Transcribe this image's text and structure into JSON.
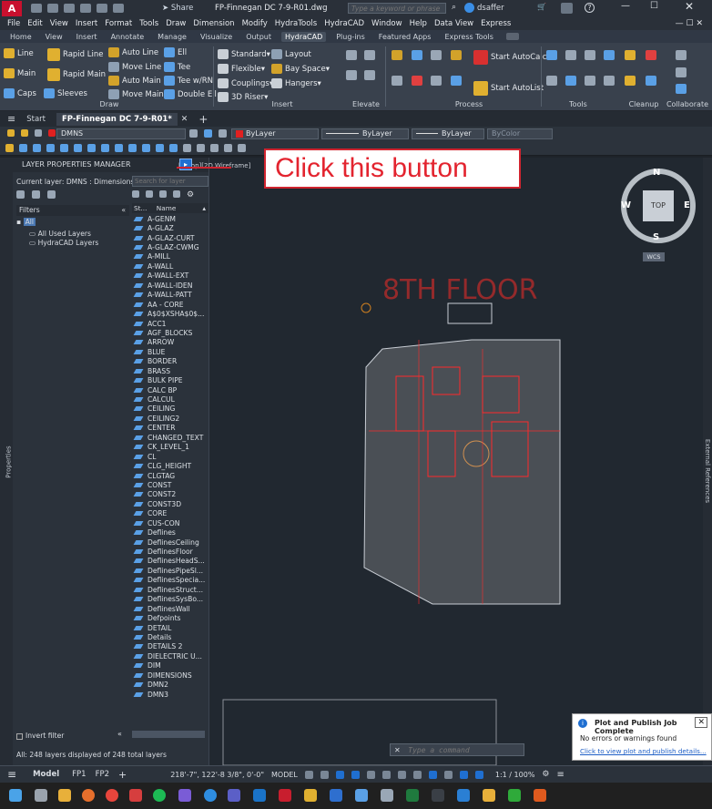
{
  "titlebar": {
    "logo": "A",
    "title": "FP-Finnegan DC 7-9-R01.dwg",
    "search_placeholder": "Type a keyword or phrase",
    "user": "dsaffer",
    "share": "Share"
  },
  "menu": [
    "File",
    "Edit",
    "View",
    "Insert",
    "Format",
    "Tools",
    "Draw",
    "Dimension",
    "Modify",
    "HydraTools",
    "HydraCAD",
    "Window",
    "Help",
    "Data View",
    "Express"
  ],
  "ribbon_tabs": [
    "Home",
    "View",
    "Insert",
    "Annotate",
    "Manage",
    "Visualize",
    "Output",
    "HydraCAD",
    "Plug-ins",
    "Featured Apps",
    "Express Tools"
  ],
  "ribbon_active": "HydraCAD",
  "ribbon": {
    "draw": [
      "Line",
      "Rapid Line",
      "Auto Line",
      "Ell",
      "Main",
      "Rapid Main",
      "Move Line",
      "Tee",
      "Caps",
      "Sleeves",
      "Auto Main",
      "Tee w/RN",
      "Move Main",
      "Double Ell"
    ],
    "insert": [
      "Standard",
      "Layout",
      "Flexible",
      "Bay Space",
      "Couplings",
      "Hangers",
      "3D Riser"
    ],
    "process": [
      "Start AutoCalc",
      "Start AutoList"
    ],
    "panels": [
      "Draw",
      "Insert",
      "Elevate",
      "Process",
      "Tools",
      "Cleanup",
      "Collaborate"
    ]
  },
  "doc_tabs": {
    "start": "Start",
    "active": "FP-Finnegan DC 7-9-R01*"
  },
  "props": {
    "layer": "DMNS",
    "color": "ByLayer",
    "linetype": "ByLayer",
    "lineweight": "ByLayer",
    "plotstyle": "ByColor"
  },
  "lpm": {
    "title": "LAYER PROPERTIES MANAGER",
    "current": "Current layer: DMNS : Dimensions and",
    "search_placeholder": "Search for layer",
    "filters_label": "Filters",
    "filter_all": "All",
    "filter_used": "All Used Layers",
    "filter_hydra": "HydraCAD Layers",
    "col_status": "St...",
    "col_name": "Name",
    "invert": "Invert filter",
    "footer": "All: 248 layers displayed of 248 total layers",
    "layers": [
      "A-GENM",
      "A-GLAZ",
      "A-GLAZ-CURT",
      "A-GLAZ-CWMG",
      "A-MILL",
      "A-WALL",
      "A-WALL-EXT",
      "A-WALL-IDEN",
      "A-WALL-PATT",
      "AA - CORE",
      "A$0$XSHA$0$...",
      "ACC1",
      "AGF_BLOCKS",
      "ARROW",
      "BLUE",
      "BORDER",
      "BRASS",
      "BULK PIPE",
      "CALC BP",
      "CALCUL",
      "CEILING",
      "CEILING2",
      "CENTER",
      "CHANGED_TEXT",
      "CK_LEVEL_1",
      "CL",
      "CLG_HEIGHT",
      "CLGTAG",
      "CONST",
      "CONST2",
      "CONST3D",
      "CORE",
      "CUS-CON",
      "Deflines",
      "DeflinesCeiling",
      "DeflinesFloor",
      "DeflinesHeadS...",
      "DeflinesPipeSl...",
      "DeflinesSpecia...",
      "DeflinesStruct...",
      "DeflinesSysBo...",
      "DeflinesWall",
      "Defpoints",
      "DETAIL",
      "Details",
      "DETAILS 2",
      "DIELECTRIC U...",
      "DIM",
      "DIMENSIONS",
      "DMN2",
      "DMN3"
    ]
  },
  "canvas": {
    "viewport_label": "[-][Top][2D Wireframe]",
    "floor_title": "8TH FLOOR",
    "viewcube_top": "TOP",
    "compass": [
      "N",
      "S",
      "E",
      "W"
    ],
    "wcs": "WCS",
    "side_left": "Properties",
    "side_right": "External References",
    "command_placeholder": "Type a command"
  },
  "callout": "Click this button",
  "notification": {
    "title": "Plot and Publish Job Complete",
    "line1": "No errors or warnings found",
    "link": "Click to view plot and publish details..."
  },
  "status": {
    "model_tab": "Model",
    "fp1": "FP1",
    "fp2": "FP2",
    "coords": "218'-7\", 122'-8 3/8\", 0'-0\"",
    "mode": "MODEL",
    "scale": "1:1 / 100%"
  },
  "colors": {
    "accent": "#1f6fd1",
    "layer_red": "#e02020",
    "drawing_red": "#ff2a2a",
    "floor_text": "#b02a2a"
  }
}
